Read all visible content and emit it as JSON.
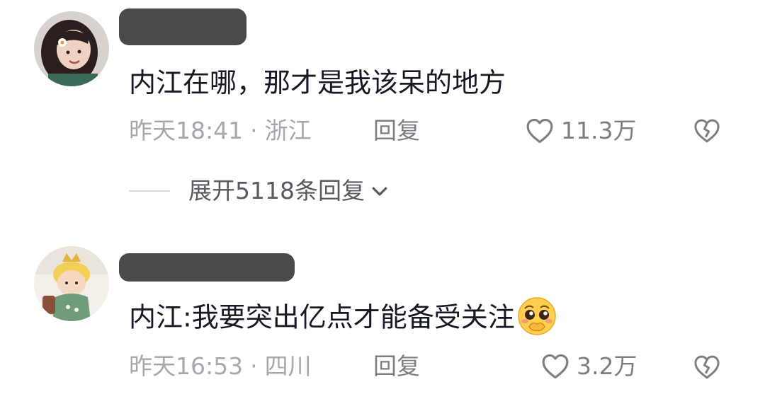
{
  "comments": [
    {
      "text": "内江在哪，那才是我该呆的地方",
      "time": "昨天18:41",
      "location": "浙江",
      "reply_label": "回复",
      "likes": "11.3万",
      "expand_label": "展开5118条回复"
    },
    {
      "text": "内江:我要突出亿点才能备受关注",
      "time": "昨天16:53",
      "location": "四川",
      "reply_label": "回复",
      "likes": "3.2万"
    }
  ],
  "separator": "·",
  "icons": {
    "like": "heart-outline-icon",
    "dislike": "broken-heart-icon",
    "expand": "chevron-down-icon",
    "emoji": "pleading-face-emoji"
  },
  "colors": {
    "text": "#161823",
    "meta": "#a7a8ad",
    "action": "#7d7e84",
    "redaction": "#4a4a4a"
  }
}
